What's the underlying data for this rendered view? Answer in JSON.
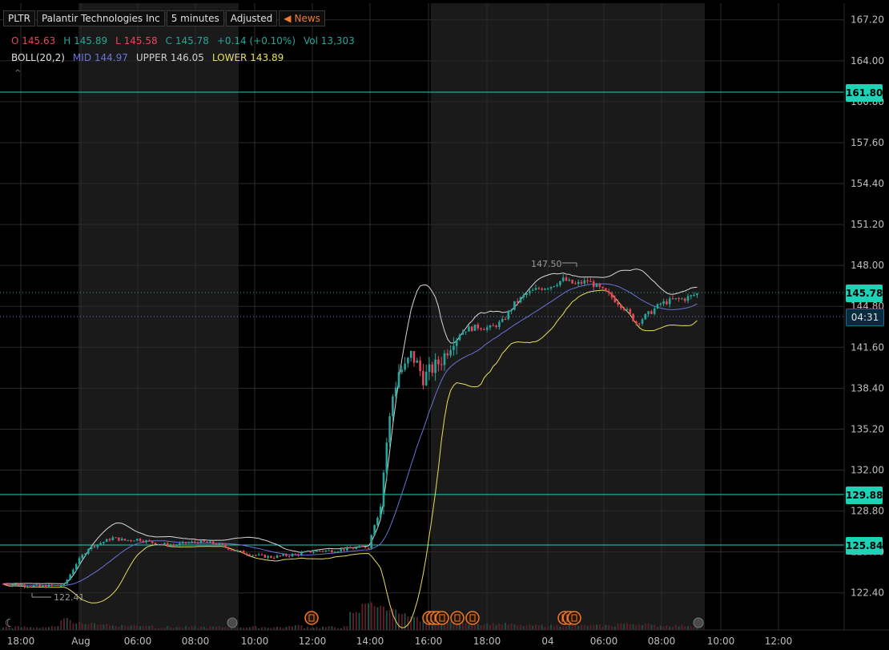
{
  "header": {
    "symbol": "PLTR",
    "company": "Palantir Technologies Inc",
    "interval": "5 minutes",
    "adjusted": "Adjusted",
    "news": "News"
  },
  "ohlc": {
    "o_label": "O",
    "o_value": "145.63",
    "h_label": "H",
    "h_value": "145.89",
    "l_label": "L",
    "l_value": "145.58",
    "c_label": "C",
    "c_value": "145.78",
    "change": "+0.14 (+0.10%)",
    "vol_label": "Vol",
    "vol_value": "13,303"
  },
  "bollinger": {
    "name": "BOLL(20,2)",
    "mid_label": "MID",
    "mid_value": "144.97",
    "upper_label": "UPPER",
    "upper_value": "146.05",
    "lower_label": "LOWER",
    "lower_value": "143.89"
  },
  "colors": {
    "up": "#26a69a",
    "down": "#e8455a",
    "upper_band": "#d8d8d8",
    "mid_band": "#6a73d9",
    "lower_band": "#e6e05a",
    "level_line": "#1fd1b5",
    "session_shade": "#1a1a1a"
  },
  "price_tags": {
    "level1": "161.80",
    "level2": "129.88",
    "level3": "125.84",
    "last_price": "145.78",
    "countdown": "04:31"
  },
  "annotations": {
    "high_marker": "147.50",
    "low_marker": "122.41"
  },
  "chart_data": {
    "type": "candlestick",
    "ylim": [
      119.5,
      168.5
    ],
    "y_ticks": [
      "167.20",
      "164.00",
      "160.80",
      "157.60",
      "154.40",
      "151.20",
      "148.00",
      "144.80",
      "141.60",
      "138.40",
      "135.20",
      "132.00",
      "128.80",
      "125.60",
      "122.40"
    ],
    "x_ticks": [
      "18:00",
      "Aug",
      "06:00",
      "08:00",
      "10:00",
      "12:00",
      "14:00",
      "16:00",
      "18:00",
      "04",
      "06:00",
      "08:00",
      "10:00",
      "12:00"
    ],
    "horizontal_levels": [
      161.8,
      129.88,
      125.84
    ],
    "last_price": 145.78,
    "session_high": 147.5,
    "session_low": 122.41,
    "price_path": [
      [
        0,
        123.1
      ],
      [
        8,
        123.0
      ],
      [
        12,
        122.9
      ],
      [
        16,
        122.95
      ],
      [
        20,
        123.0
      ],
      [
        24,
        124.7
      ],
      [
        28,
        125.9
      ],
      [
        32,
        126.3
      ],
      [
        36,
        126.7
      ],
      [
        40,
        126.5
      ],
      [
        44,
        126.6
      ],
      [
        48,
        126.4
      ],
      [
        52,
        126.2
      ],
      [
        56,
        126.1
      ],
      [
        60,
        126.3
      ],
      [
        64,
        126.4
      ],
      [
        68,
        126.3
      ],
      [
        72,
        126.1
      ],
      [
        76,
        125.7
      ],
      [
        80,
        125.5
      ],
      [
        84,
        125.3
      ],
      [
        88,
        125.2
      ],
      [
        92,
        125.3
      ],
      [
        96,
        125.4
      ],
      [
        100,
        125.6
      ],
      [
        104,
        125.7
      ],
      [
        108,
        125.7
      ],
      [
        112,
        125.8
      ],
      [
        116,
        125.9
      ],
      [
        120,
        126.0
      ],
      [
        124,
        129.6
      ],
      [
        126,
        134.2
      ],
      [
        128,
        137.8
      ],
      [
        130,
        139.7
      ],
      [
        132,
        140.0
      ],
      [
        134,
        141.0
      ],
      [
        136,
        140.3
      ],
      [
        138,
        139.2
      ],
      [
        140,
        139.7
      ],
      [
        144,
        140.6
      ],
      [
        148,
        142.3
      ],
      [
        152,
        143.0
      ],
      [
        156,
        143.2
      ],
      [
        160,
        143.1
      ],
      [
        164,
        143.6
      ],
      [
        168,
        145.0
      ],
      [
        172,
        145.8
      ],
      [
        176,
        146.2
      ],
      [
        180,
        146.4
      ],
      [
        184,
        146.9
      ],
      [
        188,
        146.5
      ],
      [
        192,
        146.8
      ],
      [
        196,
        146.2
      ],
      [
        200,
        145.5
      ],
      [
        204,
        144.7
      ],
      [
        208,
        143.5
      ],
      [
        212,
        144.2
      ],
      [
        216,
        145.0
      ],
      [
        220,
        145.3
      ],
      [
        224,
        145.4
      ],
      [
        228,
        145.78
      ]
    ],
    "volume_profile": [
      1,
      1,
      1,
      1,
      1,
      6,
      4,
      3,
      3,
      2,
      2,
      2,
      2,
      1,
      1,
      1,
      1,
      1,
      1,
      1,
      1,
      1,
      1,
      1,
      1,
      2,
      1,
      1,
      1,
      1,
      10,
      16,
      14,
      12,
      9,
      7,
      5,
      4,
      4,
      4,
      3,
      3,
      3,
      3,
      2,
      2,
      2,
      2,
      2,
      2,
      2,
      2,
      2,
      3,
      3,
      3,
      2,
      2,
      2,
      2,
      2
    ]
  }
}
